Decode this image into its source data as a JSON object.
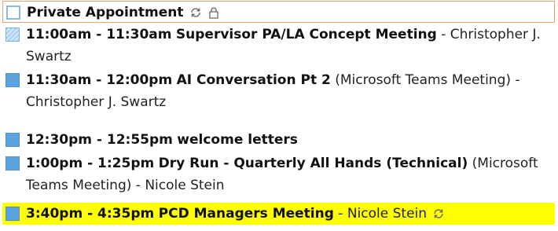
{
  "appointments": [
    {
      "title": "Private Appointment",
      "status": "empty",
      "icons": [
        "recurring-icon",
        "lock-icon"
      ]
    },
    {
      "time": "11:00am - 11:30am",
      "title": "Supervisor PA/LA Concept Meeting",
      "separator": " -",
      "organizer": "Christopher J. Swartz",
      "status": "tentative"
    },
    {
      "time": "11:30am - 12:00pm",
      "title": "AI Conversation Pt 2",
      "location": "(Microsoft Teams Meeting)",
      "organizer": "- Christopher J. Swartz",
      "status": "busy"
    },
    {
      "time": "12:30pm - 12:55pm",
      "title": "welcome letters",
      "status": "busy"
    },
    {
      "time": "1:00pm - 1:25pm",
      "title": "Dry Run - Quarterly All Hands (Technical)",
      "location": "(Microsoft Teams Meeting)",
      "organizer": "- Nicole Stein",
      "status": "busy"
    },
    {
      "time": "3:40pm - 4:35pm",
      "title": "PCD Managers Meeting",
      "organizer": "- Nicole Stein",
      "status": "busy",
      "highlight": "#ffff00",
      "icons": [
        "recurring-icon"
      ]
    }
  ]
}
